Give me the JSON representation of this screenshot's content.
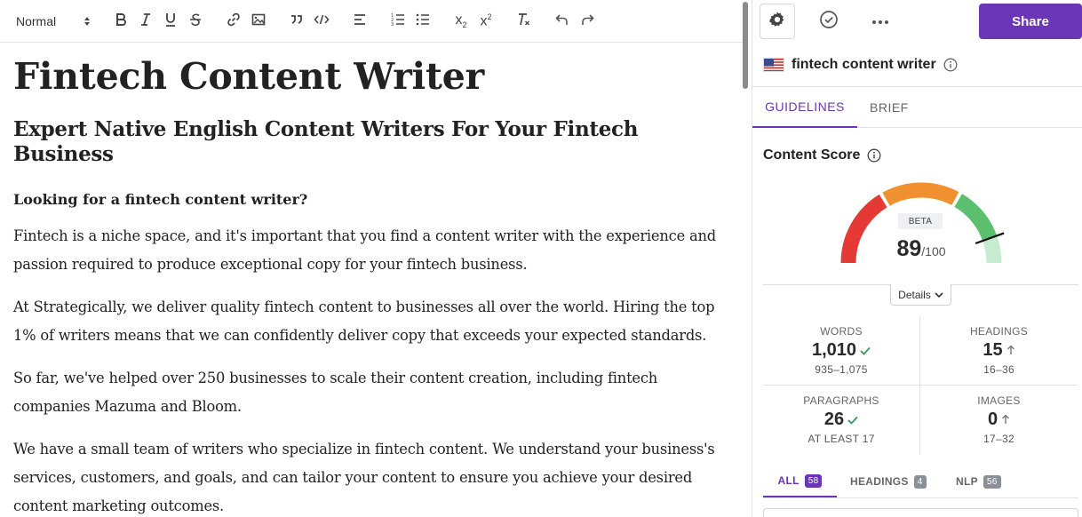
{
  "toolbar": {
    "format_select": "Normal",
    "subscript_label": "x",
    "subscript_sub": "2",
    "superscript_label": "x",
    "superscript_sup": "2",
    "clear_format_label": "T"
  },
  "document": {
    "title": "Fintech Content Writer",
    "subtitle": "Expert Native English Content Writers For Your Fintech Business",
    "question": "Looking for a fintech content writer?",
    "paragraphs": [
      "Fintech is a niche space, and it's important that you find a content writer with the experience and passion required to produce exceptional copy for your fintech business.",
      "At Strategically, we deliver quality fintech content to businesses all over the world. Hiring the top 1% of writers means that we can confidently deliver copy that exceeds your expected standards.",
      "So far, we've helped over 250 businesses to scale their content creation, including fintech companies Mazuma and Bloom.",
      "We have a small team of writers who specialize in fintech content. We understand your business's services, customers, and goals, and can tailor your content to ensure you achieve your desired content marketing outcomes."
    ]
  },
  "sidebar": {
    "share_label": "Share",
    "keyword": "fintech content writer",
    "tabs": {
      "guidelines": "GUIDELINES",
      "brief": "BRIEF"
    },
    "content_score": {
      "title": "Content Score",
      "badge": "BETA",
      "score": "89",
      "max": "/100",
      "score_fraction": 0.89,
      "details_label": "Details"
    },
    "stats": {
      "words": {
        "label": "WORDS",
        "value": "1,010",
        "range": "935–1,075",
        "status": "check"
      },
      "headings": {
        "label": "HEADINGS",
        "value": "15",
        "range": "16–36",
        "status": "up"
      },
      "paragraphs": {
        "label": "PARAGRAPHS",
        "value": "26",
        "range": "AT LEAST 17",
        "status": "check"
      },
      "images": {
        "label": "IMAGES",
        "value": "0",
        "range": "17–32",
        "status": "up"
      }
    },
    "filter_tabs": {
      "all": {
        "label": "ALL",
        "count": "58"
      },
      "headings": {
        "label": "HEADINGS",
        "count": "4"
      },
      "nlp": {
        "label": "NLP",
        "count": "56"
      }
    }
  },
  "colors": {
    "accent": "#6a35b7",
    "gauge_red": "#e53935",
    "gauge_orange": "#f0902e",
    "gauge_green": "#5cbf6e",
    "gauge_light_green": "#c6ecd0",
    "check_green": "#2e9e4f"
  },
  "icons": [
    "bold-icon",
    "italic-icon",
    "underline-icon",
    "strikethrough-icon",
    "link-icon",
    "image-icon",
    "quote-icon",
    "code-icon",
    "align-left-icon",
    "ordered-list-icon",
    "bullet-list-icon",
    "subscript-icon",
    "superscript-icon",
    "clear-format-icon",
    "undo-icon",
    "redo-icon",
    "gear-icon",
    "check-circle-icon",
    "more-icon",
    "us-flag-icon",
    "info-icon",
    "chevron-down-icon",
    "check-icon",
    "arrow-up-icon"
  ]
}
